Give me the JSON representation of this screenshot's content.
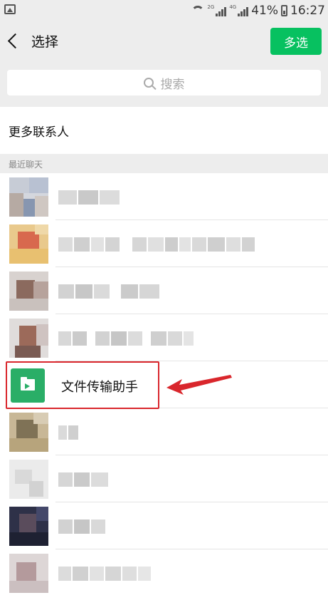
{
  "status_bar": {
    "battery_percent": "41%",
    "time": "16:27",
    "network_labels": [
      "2G",
      "4G"
    ]
  },
  "header": {
    "title": "选择",
    "multi_select_label": "多选"
  },
  "search": {
    "placeholder": "搜索"
  },
  "more_contacts": {
    "label": "更多联系人"
  },
  "recent": {
    "section_label": "最近聊天",
    "highlighted_item": "文件传输助手"
  },
  "colors": {
    "accent_green": "#07c160",
    "file_icon_green": "#2aae67",
    "highlight_red": "#d9262c"
  }
}
